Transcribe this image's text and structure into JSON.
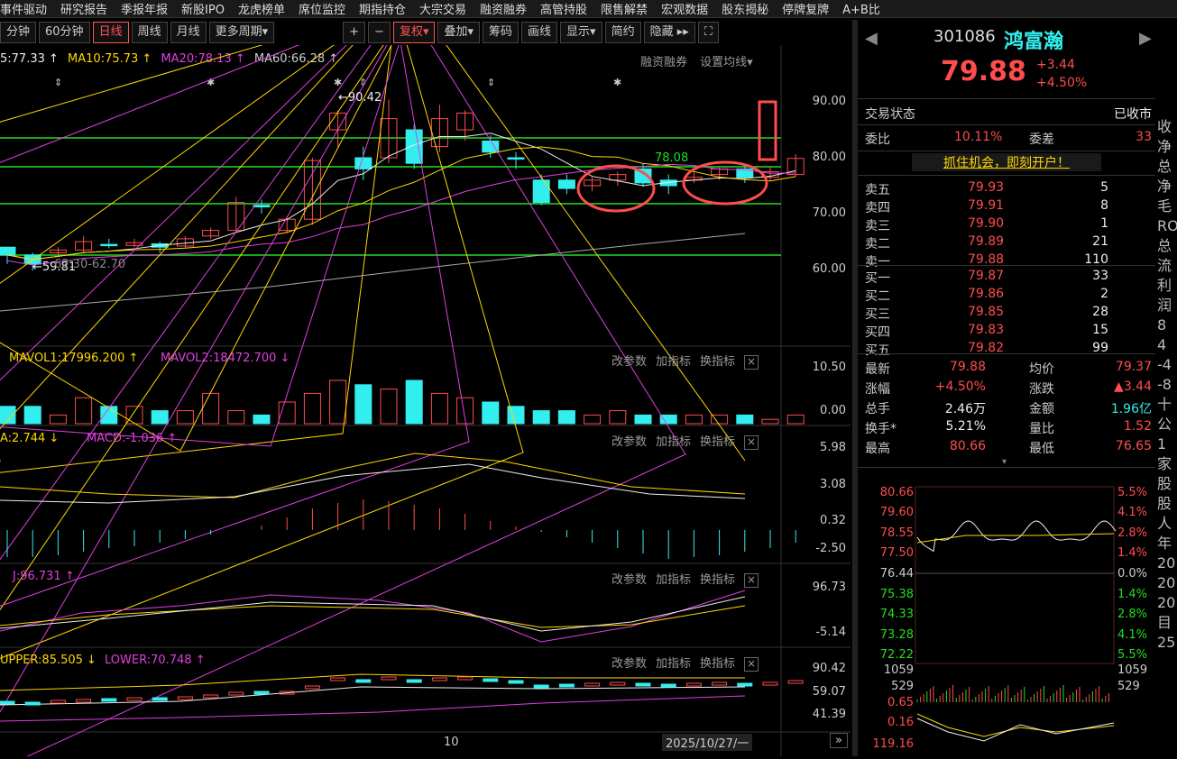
{
  "topnav": [
    "事件驱动",
    "研究报告",
    "季报年报",
    "新股IPO",
    "龙虎榜单",
    "席位监控",
    "期指持仓",
    "大宗交易",
    "融资融券",
    "高管持股",
    "限售解禁",
    "宏观数据",
    "股东揭秘",
    "停牌复牌",
    "A+B比"
  ],
  "toolbar": {
    "periods": [
      "分钟",
      "60分钟",
      "日线",
      "周线",
      "月线",
      "更多周期▾"
    ],
    "active_period": "日线",
    "buttons": [
      "+",
      "−",
      "复权▾",
      "叠加▾",
      "筹码",
      "画线",
      "显示▾",
      "简约",
      "隐藏 ▸▸"
    ]
  },
  "ma": {
    "ma5": "5:77.33 ↑",
    "ma10": "MA10:75.73 ↑",
    "ma20": "MA20:78.13 ↑",
    "ma60": "MA60:66.28 ↑",
    "links": [
      "融资融券",
      "设置均线▾"
    ]
  },
  "price_axis": [
    "90.00",
    "80.00",
    "70.00",
    "60.00"
  ],
  "annotations": {
    "high": "←90.42",
    "low": "←59.81",
    "range": "62.30-62.70",
    "level": "78.08"
  },
  "vol": {
    "title1": "MAVOL1:17996.200 ↑",
    "title2": "MAVOL2:18472.700 ↓",
    "axis": [
      "10.50",
      "0.00"
    ]
  },
  "macd": {
    "title1": "A:2.744 ↓",
    "title2": "MACD:-1.036 ↑",
    "axis": [
      "5.98",
      "3.08",
      "0.32",
      "-2.50"
    ]
  },
  "kdj": {
    "title1": "J:96.731 ↑",
    "axis": [
      "96.73",
      "-5.14"
    ]
  },
  "boll": {
    "title1": "UPPER:85.505 ↓",
    "title2": "LOWER:70.748 ↑",
    "axis": [
      "90.42",
      "59.07",
      "41.39"
    ]
  },
  "panel_buttons": [
    "改参数",
    "加指标",
    "换指标"
  ],
  "footer": {
    "tick": "10",
    "date": "2025/10/27/一"
  },
  "quote": {
    "code": "301086",
    "name": "鸿富瀚",
    "price": "79.88",
    "chg": "+3.44",
    "pct": "+4.50%",
    "status_label": "交易状态",
    "status": "已收市",
    "weibi_label": "委比",
    "weibi": "10.11%",
    "weicha_label": "委差",
    "weicha": "33",
    "promo": "抓住机会，即刻开户！",
    "asks": [
      {
        "l": "卖五",
        "p": "79.93",
        "v": "5"
      },
      {
        "l": "卖四",
        "p": "79.91",
        "v": "8"
      },
      {
        "l": "卖三",
        "p": "79.90",
        "v": "1"
      },
      {
        "l": "卖二",
        "p": "79.89",
        "v": "21"
      },
      {
        "l": "卖一",
        "p": "79.88",
        "v": "110"
      }
    ],
    "bids": [
      {
        "l": "买一",
        "p": "79.87",
        "v": "33"
      },
      {
        "l": "买二",
        "p": "79.86",
        "v": "2"
      },
      {
        "l": "买三",
        "p": "79.85",
        "v": "28"
      },
      {
        "l": "买四",
        "p": "79.83",
        "v": "15"
      },
      {
        "l": "买五",
        "p": "79.82",
        "v": "99"
      }
    ],
    "stats": [
      {
        "l1": "最新",
        "v1": "79.88",
        "l2": "均价",
        "v2": "79.37"
      },
      {
        "l1": "涨幅",
        "v1": "+4.50%",
        "l2": "涨跌",
        "v2": "▲3.44"
      },
      {
        "l1": "总手",
        "v1": "2.46万",
        "l2": "金额",
        "v2": "1.96亿"
      },
      {
        "l1": "换手*",
        "v1": "5.21%",
        "l2": "量比",
        "v2": "1.52"
      },
      {
        "l1": "最高",
        "v1": "80.66",
        "l2": "最低",
        "v2": "76.65"
      }
    ],
    "mini_left": [
      "80.66",
      "79.60",
      "78.55",
      "77.50",
      "76.44",
      "75.38",
      "74.33",
      "73.28",
      "72.22",
      "1059",
      "529",
      "0.65",
      "0.16",
      "119.16"
    ],
    "mini_right": [
      "5.5%",
      "4.1%",
      "2.8%",
      "1.4%",
      "0.0%",
      "1.4%",
      "2.8%",
      "4.1%",
      "5.5%",
      "1059",
      "529"
    ]
  },
  "edge": [
    "收",
    "净",
    "总",
    "净",
    "毛",
    "RO",
    "总",
    "流",
    "利润",
    "8",
    "4",
    "-4",
    "-8",
    "十",
    "公",
    "1家",
    "股",
    "股",
    "人",
    "年",
    "20",
    "20",
    "20",
    "目",
    "25"
  ],
  "colors": {
    "up": "#ff4d4d",
    "down": "#22dd22",
    "cyan": "#3ee",
    "yellow": "#ffd700",
    "magenta": "#e040e0"
  }
}
